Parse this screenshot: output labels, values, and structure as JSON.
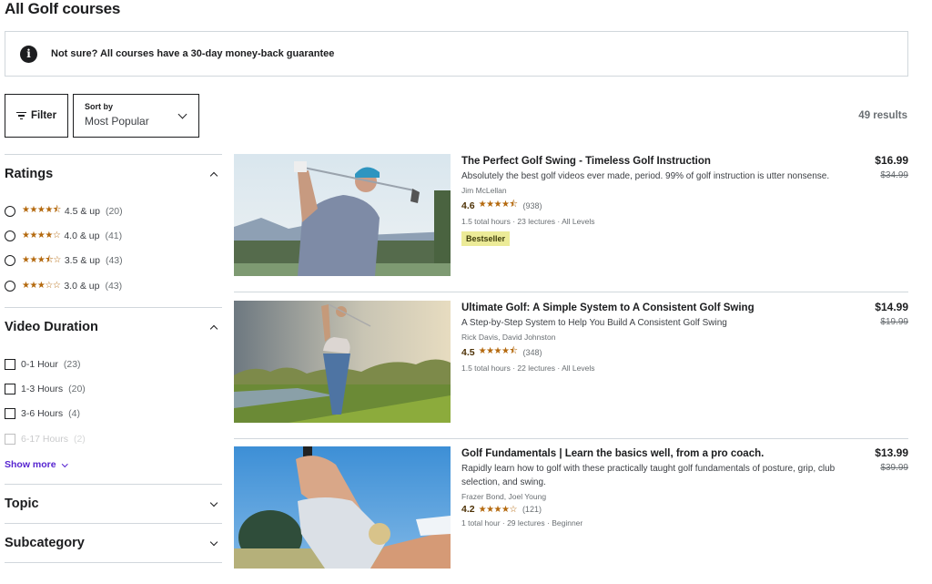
{
  "page": {
    "title": "All Golf courses",
    "notice": "Not sure? All courses have a 30-day money-back guarantee",
    "results_count": "49 results"
  },
  "toolbar": {
    "filter_label": "Filter",
    "sort_label": "Sort by",
    "sort_value": "Most Popular"
  },
  "sidebar": {
    "ratings": {
      "title": "Ratings",
      "expanded": true,
      "options": [
        {
          "stars": "★★★★⯪",
          "label": "4.5 & up",
          "count": "(20)"
        },
        {
          "stars": "★★★★☆",
          "label": "4.0 & up",
          "count": "(41)"
        },
        {
          "stars": "★★★⯪☆",
          "label": "3.5 & up",
          "count": "(43)"
        },
        {
          "stars": "★★★☆☆",
          "label": "3.0 & up",
          "count": "(43)"
        }
      ]
    },
    "video_duration": {
      "title": "Video Duration",
      "expanded": true,
      "options": [
        {
          "label": "0-1 Hour",
          "count": "(23)"
        },
        {
          "label": "1-3 Hours",
          "count": "(20)"
        },
        {
          "label": "3-6 Hours",
          "count": "(4)"
        },
        {
          "label": "6-17 Hours",
          "count": "(2)"
        }
      ],
      "show_more": "Show more"
    },
    "topic": {
      "title": "Topic",
      "expanded": false
    },
    "subcategory": {
      "title": "Subcategory",
      "expanded": false
    }
  },
  "courses": [
    {
      "title": "The Perfect Golf Swing - Timeless Golf Instruction",
      "description": "Absolutely the best golf videos ever made, period. 99% of golf instruction is utter nonsense.",
      "instructors": "Jim McLellan",
      "rating": "4.6",
      "stars": "★★★★⯪",
      "reviews": "(938)",
      "meta": "1.5 total hours · 23 lectures · All Levels",
      "badge": "Bestseller",
      "price": "$16.99",
      "original_price": "$34.99"
    },
    {
      "title": "Ultimate Golf: A Simple System to A Consistent Golf Swing",
      "description": "A Step-by-Step System to Help You Build A Consistent Golf Swing",
      "instructors": "Rick Davis, David Johnston",
      "rating": "4.5",
      "stars": "★★★★⯪",
      "reviews": "(348)",
      "meta": "1.5 total hours · 22 lectures · All Levels",
      "price": "$14.99",
      "original_price": "$19.99"
    },
    {
      "title": "Golf Fundamentals | Learn the basics well, from a pro coach.",
      "description": "Rapidly learn how to golf with these practically taught golf fundamentals of posture, grip, club selection, and swing.",
      "instructors": "Frazer Bond, Joel Young",
      "rating": "4.2",
      "stars": "★★★★☆",
      "reviews": "(121)",
      "meta": "1 total hour · 29 lectures · Beginner",
      "price": "$13.99",
      "original_price": "$39.99"
    }
  ],
  "colors": {
    "star": "#b4690e",
    "link": "#5624d0",
    "badge_bg": "#eceb98",
    "border": "#d1d7dc"
  }
}
